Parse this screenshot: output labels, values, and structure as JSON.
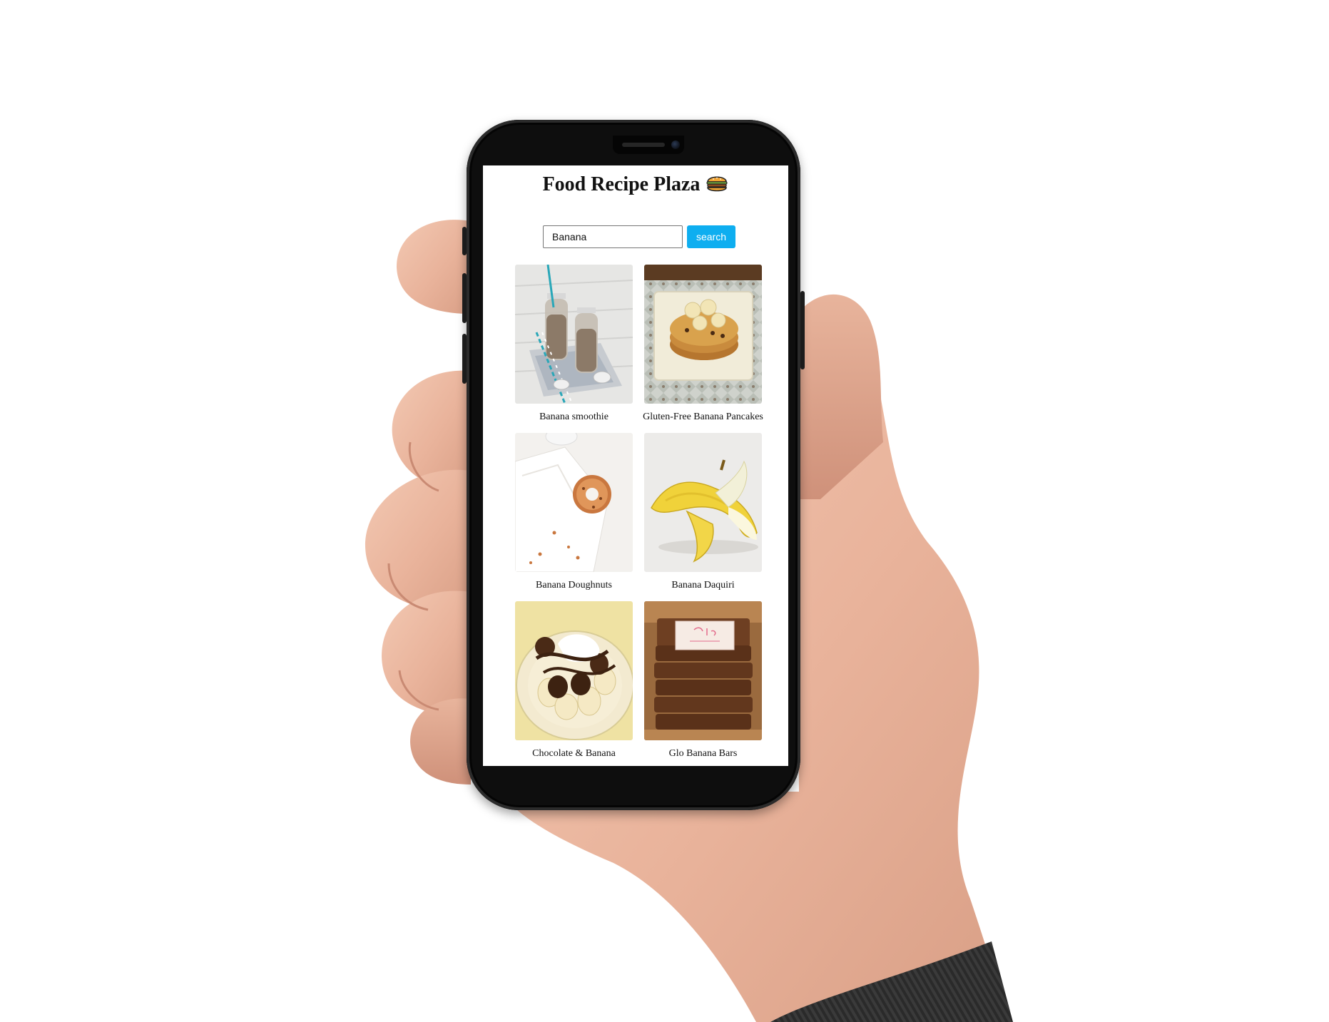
{
  "app": {
    "title": "Food Recipe Plaza",
    "title_icon": "burger-icon"
  },
  "search": {
    "value": "Banana",
    "button_label": "search"
  },
  "recipes": [
    {
      "label": "Banana smoothie",
      "image": "smoothie-bottles-photo"
    },
    {
      "label": "Gluten-Free Banana Pancakes",
      "image": "pancake-stack-photo"
    },
    {
      "label": "Banana Doughnuts",
      "image": "doughnut-photo"
    },
    {
      "label": "Banana Daquiri",
      "image": "peeled-banana-photo"
    },
    {
      "label": "Chocolate & Banana",
      "image": "chocolate-banana-photo"
    },
    {
      "label": "Glo Banana Bars",
      "image": "banana-bars-photo"
    }
  ],
  "colors": {
    "search_button": "#0eaef0",
    "phone_body": "#0e0e0e"
  }
}
